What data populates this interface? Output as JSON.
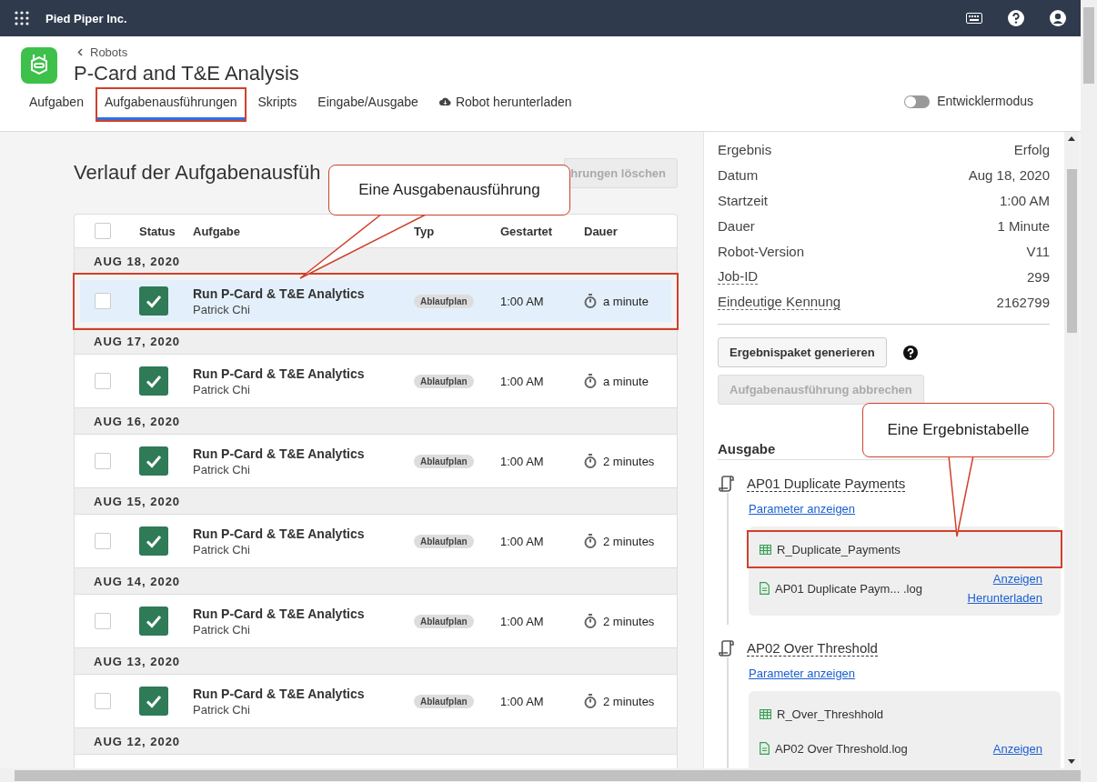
{
  "app_bar": {
    "org": "Pied Piper Inc."
  },
  "header": {
    "breadcrumb": "Robots",
    "title": "P-Card and T&E Analysis",
    "tabs": [
      {
        "label": "Aufgaben",
        "selected": false,
        "highlighted": false,
        "kind": "plain"
      },
      {
        "label": "Aufgabenausführungen",
        "selected": true,
        "highlighted": true,
        "kind": "plain"
      },
      {
        "label": "Skripts",
        "selected": false,
        "highlighted": false,
        "kind": "plain"
      },
      {
        "label": "Eingabe/Ausgabe",
        "selected": false,
        "highlighted": false,
        "kind": "plain"
      },
      {
        "label": "Robot herunterladen",
        "selected": false,
        "highlighted": false,
        "kind": "download"
      }
    ],
    "dev_mode": {
      "label": "Entwicklermodus",
      "on": false
    }
  },
  "history": {
    "title": "Verlauf der Aufgabenausfüh",
    "clear_button": {
      "label": "hrungen löschen",
      "disabled": true
    },
    "select_all": {
      "checked": false
    },
    "columns": [
      "Status",
      "Aufgabe",
      "Typ",
      "Gestartet",
      "Dauer"
    ],
    "groups": [
      {
        "date": "AUG 18, 2020",
        "runs": [
          {
            "task": "Run P-Card & T&E Analytics",
            "user": "Patrick Chi",
            "type": "Ablaufplan",
            "started": "1:00 AM",
            "duration": "a minute",
            "kind": "success",
            "checked": false,
            "selected": true,
            "highlighted": true
          }
        ]
      },
      {
        "date": "AUG 17, 2020",
        "runs": [
          {
            "task": "Run P-Card & T&E Analytics",
            "user": "Patrick Chi",
            "type": "Ablaufplan",
            "started": "1:00 AM",
            "duration": "a minute",
            "kind": "success",
            "checked": false,
            "selected": false,
            "highlighted": false
          }
        ]
      },
      {
        "date": "AUG 16, 2020",
        "runs": [
          {
            "task": "Run P-Card & T&E Analytics",
            "user": "Patrick Chi",
            "type": "Ablaufplan",
            "started": "1:00 AM",
            "duration": "2 minutes",
            "kind": "success",
            "checked": false,
            "selected": false,
            "highlighted": false
          }
        ]
      },
      {
        "date": "AUG 15, 2020",
        "runs": [
          {
            "task": "Run P-Card & T&E Analytics",
            "user": "Patrick Chi",
            "type": "Ablaufplan",
            "started": "1:00 AM",
            "duration": "2 minutes",
            "kind": "success",
            "checked": false,
            "selected": false,
            "highlighted": false
          }
        ]
      },
      {
        "date": "AUG 14, 2020",
        "runs": [
          {
            "task": "Run P-Card & T&E Analytics",
            "user": "Patrick Chi",
            "type": "Ablaufplan",
            "started": "1:00 AM",
            "duration": "2 minutes",
            "kind": "success",
            "checked": false,
            "selected": false,
            "highlighted": false
          }
        ]
      },
      {
        "date": "AUG 13, 2020",
        "runs": [
          {
            "task": "Run P-Card & T&E Analytics",
            "user": "Patrick Chi",
            "type": "Ablaufplan",
            "started": "1:00 AM",
            "duration": "2 minutes",
            "kind": "success",
            "checked": false,
            "selected": false,
            "highlighted": false
          }
        ]
      },
      {
        "date": "AUG 12, 2020"
      }
    ]
  },
  "details": {
    "fields": [
      {
        "label": "Ergebnis",
        "value": "Erfolg",
        "kind": "plain"
      },
      {
        "label": "Datum",
        "value": "Aug 18, 2020",
        "kind": "plain"
      },
      {
        "label": "Startzeit",
        "value": "1:00 AM",
        "kind": "plain"
      },
      {
        "label": "Dauer",
        "value": "1 Minute",
        "kind": "plain"
      },
      {
        "label": "Robot-Version",
        "value": "V11",
        "kind": "plain"
      },
      {
        "label": "Job-ID",
        "value": "299",
        "kind": "dotted"
      },
      {
        "label": "Eindeutige Kennung",
        "value": "2162799",
        "kind": "dotted"
      }
    ],
    "buttons": [
      {
        "label": "Ergebnispaket generieren",
        "disabled": false,
        "help": true
      },
      {
        "label": "Aufgabenausführung abbrechen",
        "disabled": true,
        "help": false
      }
    ],
    "output": {
      "title": "Ausgabe",
      "scripts": [
        {
          "name": "AP01 Duplicate Payments",
          "params_link": "Parameter anzeigen",
          "files": [
            {
              "kind": "table",
              "name": "R_Duplicate_Payments",
              "highlighted": true
            },
            {
              "kind": "log",
              "name": "AP01 Duplicate Paym... .log",
              "highlighted": false,
              "links": [
                "Anzeigen",
                "Herunterladen"
              ]
            }
          ]
        },
        {
          "name": "AP02 Over Threshold",
          "params_link": "Parameter anzeigen",
          "files": [
            {
              "kind": "table",
              "name": "R_Over_Threshhold",
              "highlighted": false
            },
            {
              "kind": "log",
              "name": "AP02 Over Threshold.log",
              "highlighted": false,
              "links": [
                "Anzeigen"
              ]
            }
          ]
        }
      ]
    }
  },
  "callouts": [
    {
      "text": "Eine Ausgabenausführung"
    },
    {
      "text": "Eine Ergebnistabelle"
    }
  ]
}
